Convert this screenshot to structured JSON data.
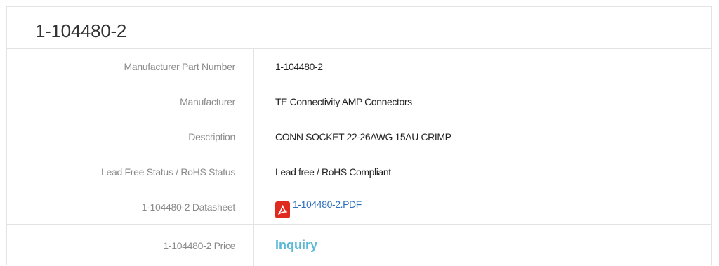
{
  "title": "1-104480-2",
  "rows": [
    {
      "label": "Manufacturer Part Number",
      "value": "1-104480-2"
    },
    {
      "label": "Manufacturer",
      "value": "TE Connectivity AMP Connectors"
    },
    {
      "label": "Description",
      "value": "CONN SOCKET 22-26AWG 15AU CRIMP"
    },
    {
      "label": "Lead Free Status / RoHS Status",
      "value": "Lead free / RoHS Compliant"
    },
    {
      "label": "1-104480-2 Datasheet",
      "value": "1-104480-2.PDF",
      "icon": "pdf-icon"
    },
    {
      "label": "1-104480-2 Price",
      "value": "Inquiry"
    }
  ],
  "colors": {
    "pdf_icon": "#e02a20",
    "link": "#2d6fbf",
    "inquiry": "#5bb8d6"
  }
}
